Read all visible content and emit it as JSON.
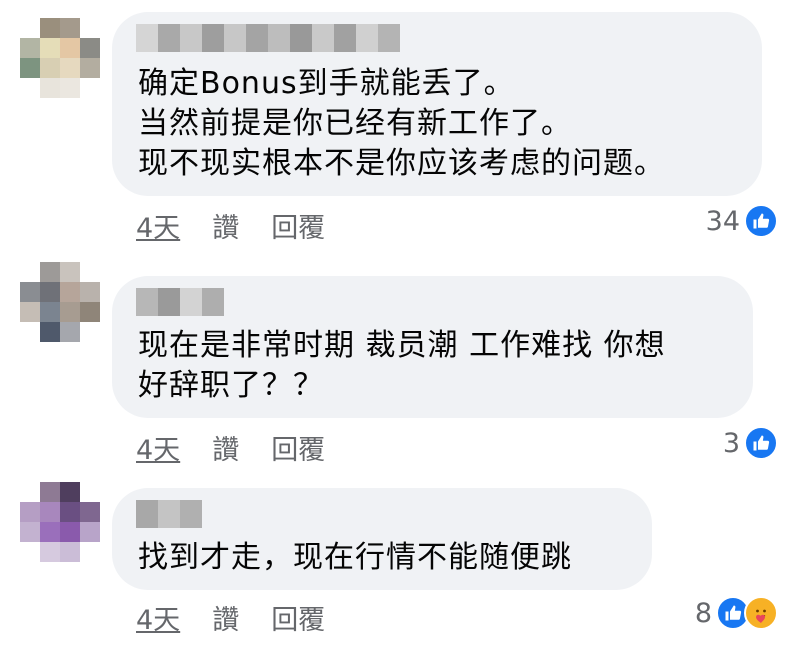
{
  "comments": [
    {
      "text_lines": [
        "确定Bonus到手就能丢了。",
        "当然前提是你已经有新工作了。",
        "现不现实根本不是你应该考虑的问题。"
      ],
      "time": "4天",
      "like_action": "讚",
      "reply_action": "回覆",
      "reaction_count": "34",
      "reactions": [
        "like-icon"
      ]
    },
    {
      "text_lines": [
        "现在是非常时期 裁员潮 工作难找 你想",
        "好辞职了？？"
      ],
      "time": "4天",
      "like_action": "讚",
      "reply_action": "回覆",
      "reaction_count": "3",
      "reactions": [
        "like-icon"
      ]
    },
    {
      "text_lines": [
        "找到才走，现在行情不能随便跳"
      ],
      "time": "4天",
      "like_action": "讚",
      "reply_action": "回覆",
      "reaction_count": "8",
      "reactions": [
        "like-icon",
        "care-icon"
      ]
    }
  ],
  "colors": {
    "bubble": "#f0f2f5",
    "meta_text": "#65676b",
    "like_blue": "#1877f2",
    "care_yellow": "#f7b125"
  }
}
